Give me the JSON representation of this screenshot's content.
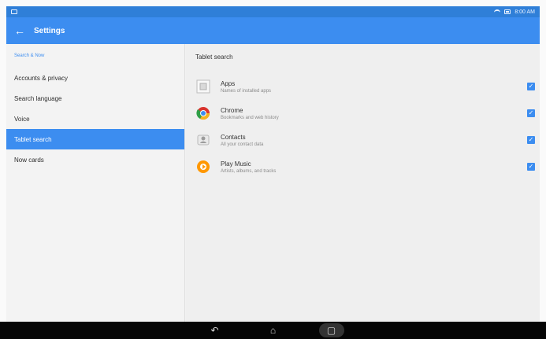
{
  "app": {
    "title": "Settings"
  },
  "sidebar": {
    "section_label": "Search & Now",
    "items": [
      {
        "label": "Accounts & privacy"
      },
      {
        "label": "Search language"
      },
      {
        "label": "Voice"
      },
      {
        "label": "Tablet search",
        "active": true
      },
      {
        "label": "Now cards"
      }
    ]
  },
  "main": {
    "title": "Tablet search",
    "items": [
      {
        "title": "Apps",
        "subtitle": "Names of installed apps",
        "checked": true,
        "icon": "apps-icon"
      },
      {
        "title": "Chrome",
        "subtitle": "Bookmarks and web history",
        "checked": true,
        "icon": "chrome-icon"
      },
      {
        "title": "Contacts",
        "subtitle": "All your contact data",
        "checked": true,
        "icon": "contacts-icon"
      },
      {
        "title": "Play Music",
        "subtitle": "Artists, albums, and tracks",
        "checked": true,
        "icon": "play-music-icon"
      }
    ]
  },
  "colors": {
    "status_bar": "#2f7fd8",
    "app_bar": "#3c8df0",
    "active_item": "#3c8df0",
    "checkbox": "#3c8df0"
  },
  "status": {
    "time": "8:00 AM"
  }
}
